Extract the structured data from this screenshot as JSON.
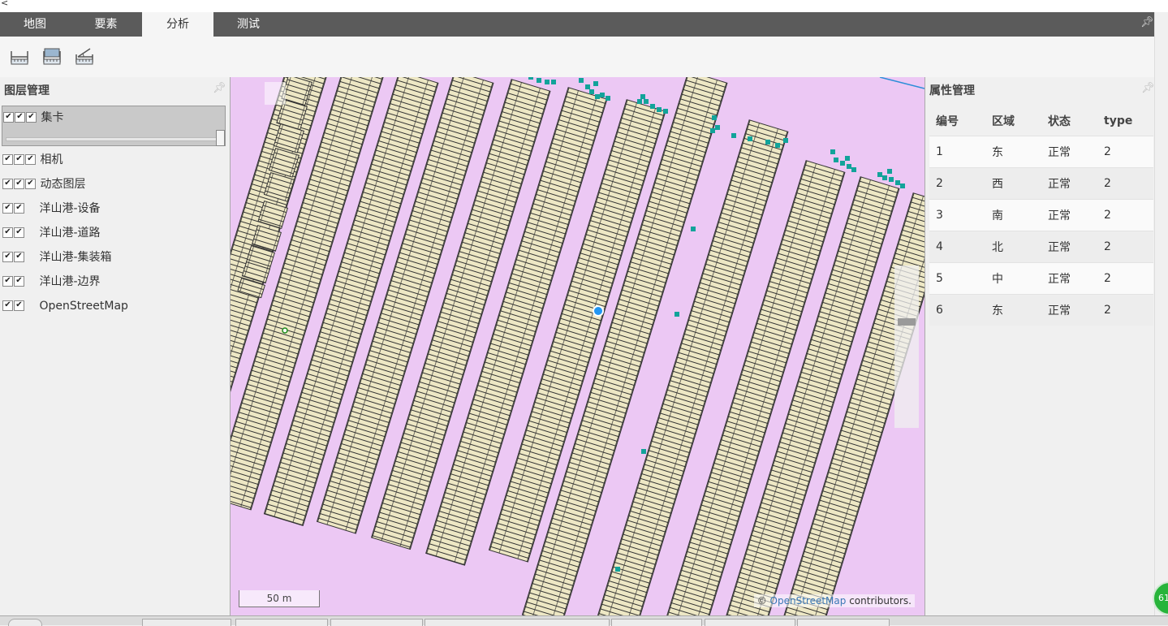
{
  "window": {
    "corner_char": "<"
  },
  "tabs": [
    {
      "label": "地图"
    },
    {
      "label": "要素"
    },
    {
      "label": "分析"
    },
    {
      "label": "测试"
    }
  ],
  "active_tab": "分析",
  "toolbar": {
    "tools": [
      "measure-length-icon",
      "measure-area-icon",
      "measure-angle-icon"
    ]
  },
  "layer_panel": {
    "title": "图层管理",
    "selected_layer": {
      "name": "集卡",
      "checks": 3,
      "opacity": 1.0
    },
    "layers": [
      {
        "name": "相机",
        "checks": 3
      },
      {
        "name": "动态图层",
        "checks": 3
      },
      {
        "name": "洋山港-设备",
        "checks": 2
      },
      {
        "name": "洋山港-道路",
        "checks": 2
      },
      {
        "name": "洋山港-集装箱",
        "checks": 2
      },
      {
        "name": "洋山港-边界",
        "checks": 2
      },
      {
        "name": "OpenStreetMap",
        "checks": 2
      }
    ]
  },
  "map": {
    "scale_label": "50 m",
    "attribution_prefix": "©",
    "attribution_link": "OpenStreetMap",
    "attribution_suffix": "contributors.",
    "colors": {
      "background": "#ecc8f4",
      "container": "#ede7c4",
      "equipment": "#12a39a",
      "marker": "#2196f3"
    }
  },
  "attr_panel": {
    "title": "属性管理",
    "columns": [
      "编号",
      "区域",
      "状态",
      "type"
    ],
    "rows": [
      [
        "1",
        "东",
        "正常",
        "2"
      ],
      [
        "2",
        "西",
        "正常",
        "2"
      ],
      [
        "3",
        "南",
        "正常",
        "2"
      ],
      [
        "4",
        "北",
        "正常",
        "2"
      ],
      [
        "5",
        "中",
        "正常",
        "2"
      ],
      [
        "6",
        "东",
        "正常",
        "2"
      ]
    ]
  },
  "badge": {
    "text": "61"
  }
}
